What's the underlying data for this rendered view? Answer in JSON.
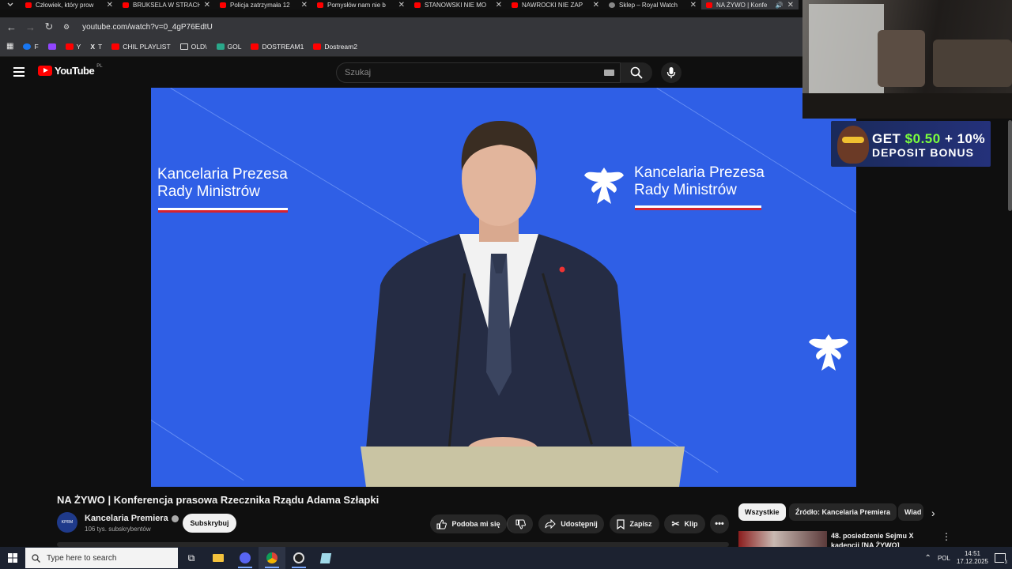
{
  "browser": {
    "tabs": [
      {
        "title": "Człowiek, który prow",
        "icon": "youtube"
      },
      {
        "title": "BRUKSELA W STRACH",
        "icon": "youtube"
      },
      {
        "title": "Policja zatrzymała 12",
        "icon": "youtube"
      },
      {
        "title": "Pomysłów nam nie b",
        "icon": "youtube"
      },
      {
        "title": "STANOWSKI NIE MO",
        "icon": "youtube"
      },
      {
        "title": "NAWROCKI NIE ZAP",
        "icon": "youtube"
      },
      {
        "title": "Sklep – Royal Watch",
        "icon": "globe"
      },
      {
        "title": "NA ŻYWO | Konfe",
        "icon": "youtube",
        "active": true
      }
    ],
    "close_glyph": "✕",
    "url": "youtube.com/watch?v=0_4gP76EdtU",
    "bookmarks": [
      {
        "label": "F",
        "icon": "facebook"
      },
      {
        "label": "",
        "icon": "twitch"
      },
      {
        "label": "Y",
        "icon": "youtube"
      },
      {
        "label": "T",
        "icon": "x"
      },
      {
        "label": "CHIL PLAYLIST",
        "icon": "youtube"
      },
      {
        "label": "OLD\\",
        "icon": "folder"
      },
      {
        "label": "GOL",
        "icon": "g"
      },
      {
        "label": "DOSTREAM1",
        "icon": "youtube"
      },
      {
        "label": "Dostream2",
        "icon": "youtube"
      }
    ]
  },
  "youtube": {
    "logo_text": "YouTube",
    "country_code": "PL",
    "search_placeholder": "Szukaj"
  },
  "player": {
    "overlay_left": [
      "Kancelaria Prezesa",
      "Rady Ministrów"
    ],
    "overlay_right": [
      "Kancelaria Prezesa",
      "Rady Ministrów"
    ]
  },
  "overlays": {
    "ad_line1_a": "GET ",
    "ad_line1_b": "$0.50",
    "ad_line1_c": " + 10%",
    "ad_line2": "DEPOSIT BONUS"
  },
  "video": {
    "title": "NA ŻYWO | Konferencja prasowa Rzecznika Rządu Adama Szłapki",
    "channel": "Kancelaria Premiera",
    "avatar_text": "KPRM",
    "subscribers": "106 tys. subskrybentów",
    "subscribe_label": "Subskrybuj",
    "like_label": "Podoba mi się",
    "share_label": "Udostępnij",
    "save_label": "Zapisz",
    "clip_label": "Klip"
  },
  "sidebar": {
    "chips": [
      "Wszystkie",
      "Źródło: Kancelaria Premiera",
      "Wiad"
    ],
    "rec_title": "48. posiedzenie Sejmu X kadencji [NA ŻYWO]"
  },
  "taskbar": {
    "search_placeholder": "Type here to search",
    "language": "POL",
    "time": "14:51",
    "date": "17.12.2025",
    "notifications": "3"
  }
}
